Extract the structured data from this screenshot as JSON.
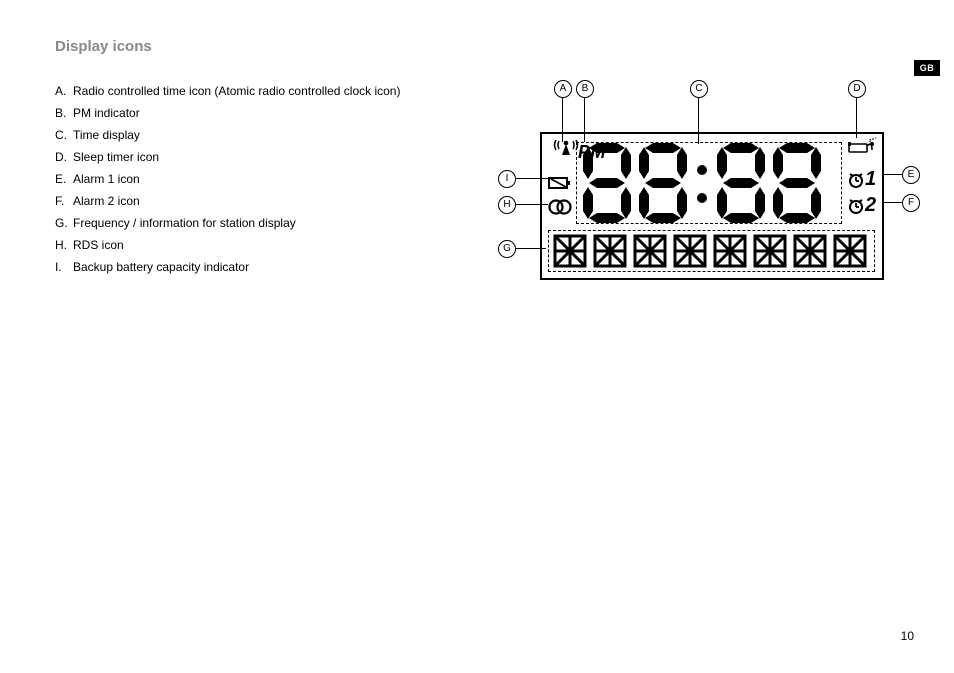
{
  "title": "Display icons",
  "language_tab": "GB",
  "page_number": "10",
  "legend": {
    "A": "Radio controlled time icon (Atomic radio controlled clock icon)",
    "B": "PM indicator",
    "C": "Time display",
    "D": "Sleep timer icon",
    "E": "Alarm 1 icon",
    "F": "Alarm 2 icon",
    "G": "Frequency / information for station display",
    "H": "RDS icon",
    "I": "Backup battery capacity indicator"
  },
  "callouts": {
    "A": "A",
    "B": "B",
    "C": "C",
    "D": "D",
    "E": "E",
    "F": "F",
    "G": "G",
    "H": "H",
    "I": "I"
  },
  "display": {
    "pm_text": "PM",
    "alarm1_number": "1",
    "alarm2_number": "2"
  }
}
